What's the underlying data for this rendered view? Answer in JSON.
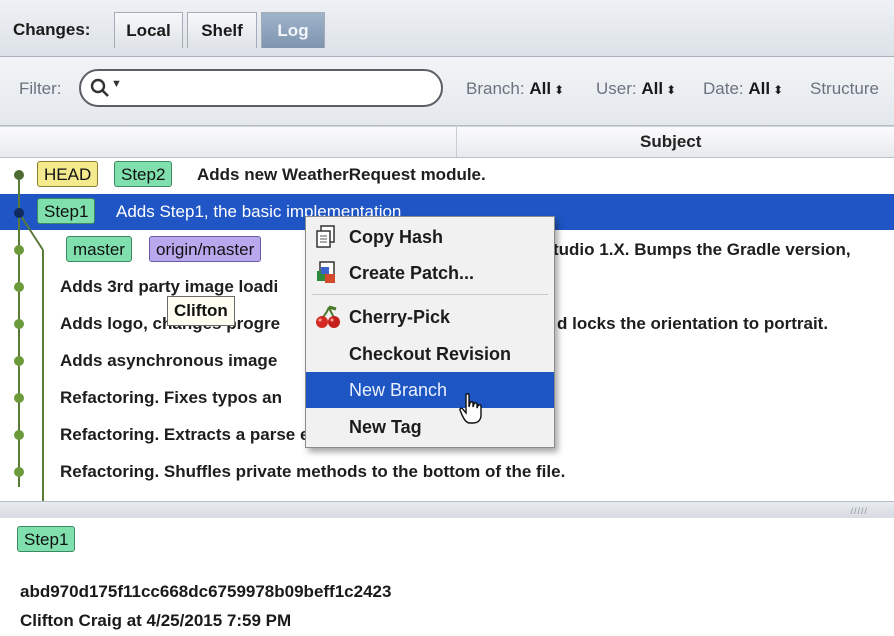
{
  "tabs": {
    "changes_label": "Changes:",
    "items": [
      {
        "label": "Local",
        "active": false
      },
      {
        "label": "Shelf",
        "active": false
      },
      {
        "label": "Log",
        "active": true
      }
    ]
  },
  "filter": {
    "label": "Filter:",
    "search_icon": "search-icon",
    "search_value": "",
    "branch": {
      "label": "Branch:",
      "value": "All"
    },
    "user": {
      "label": "User:",
      "value": "All"
    },
    "date": {
      "label": "Date:",
      "value": "All"
    },
    "structure": {
      "label": "Structure"
    }
  },
  "columns": {
    "subject": "Subject"
  },
  "commits": [
    {
      "tags": [
        "HEAD",
        "Step2"
      ],
      "subject": "Adds new WeatherRequest module."
    },
    {
      "tags": [
        "Step1"
      ],
      "subject": "Adds Step1, the basic implementation",
      "selected": true
    },
    {
      "tags": [
        "master",
        "origin/master"
      ],
      "subject": "tudio 1.X. Bumps the Gradle version,"
    },
    {
      "tags": [],
      "subject": "Adds 3rd party image loadi"
    },
    {
      "tags": [],
      "subject": "Adds logo, changes progre",
      "subject_tail": "d locks the orientation to portrait."
    },
    {
      "tags": [],
      "subject": "Adds asynchronous image"
    },
    {
      "tags": [],
      "subject": "Refactoring. Fixes typos an"
    },
    {
      "tags": [],
      "subject": "Refactoring. Extracts a parse event handler."
    },
    {
      "tags": [],
      "subject": "Refactoring. Shuffles private methods to the bottom of the file."
    }
  ],
  "tooltip": "Clifton",
  "context_menu": {
    "items": [
      {
        "label": "Copy Hash",
        "icon": "copy-icon"
      },
      {
        "label": "Create Patch...",
        "icon": "patch-icon"
      },
      {
        "label": "Cherry-Pick",
        "icon": "cherry-icon"
      },
      {
        "label": "Checkout Revision",
        "icon": ""
      },
      {
        "label": "New Branch",
        "icon": "",
        "highlighted": true
      },
      {
        "label": "New Tag",
        "icon": ""
      }
    ]
  },
  "details": {
    "tag": "Step1",
    "hash": "abd970d175f11cc668dc6759978b09beff1c2423",
    "author_line": "Clifton Craig at 4/25/2015 7:59 PM"
  },
  "colors": {
    "selection": "#1f55c4",
    "graph": "#5a7a3a",
    "head_tag": "#f4e98d",
    "branch_tag": "#7fe0ad",
    "remote_tag": "#b9a8ee"
  }
}
